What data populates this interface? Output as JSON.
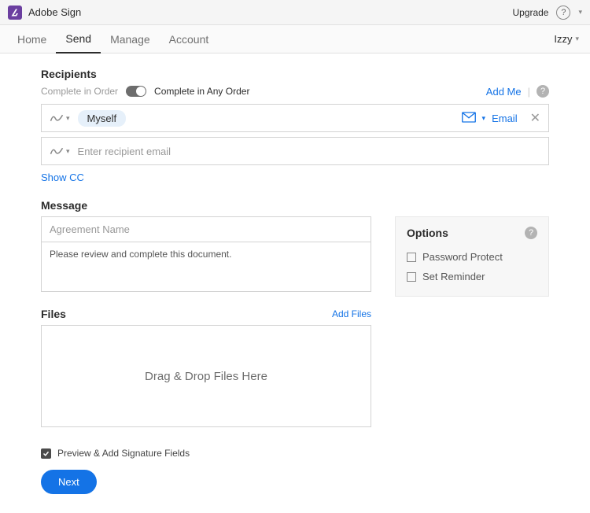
{
  "app": {
    "title": "Adobe Sign",
    "upgrade": "Upgrade"
  },
  "nav": {
    "tabs": [
      "Home",
      "Send",
      "Manage",
      "Account"
    ],
    "active": "Send",
    "user": "Izzy"
  },
  "recipients": {
    "heading": "Recipients",
    "order_muted": "Complete in Order",
    "order_active": "Complete in Any Order",
    "add_me": "Add Me",
    "chip": "Myself",
    "email_label": "Email",
    "placeholder": "Enter recipient email",
    "show_cc": "Show CC"
  },
  "message": {
    "heading": "Message",
    "name_placeholder": "Agreement Name",
    "body": "Please review and complete this document."
  },
  "options": {
    "heading": "Options",
    "items": [
      "Password Protect",
      "Set Reminder"
    ]
  },
  "files": {
    "heading": "Files",
    "add": "Add Files",
    "dropzone": "Drag & Drop Files Here"
  },
  "footer": {
    "preview_label": "Preview & Add Signature Fields",
    "next": "Next"
  }
}
